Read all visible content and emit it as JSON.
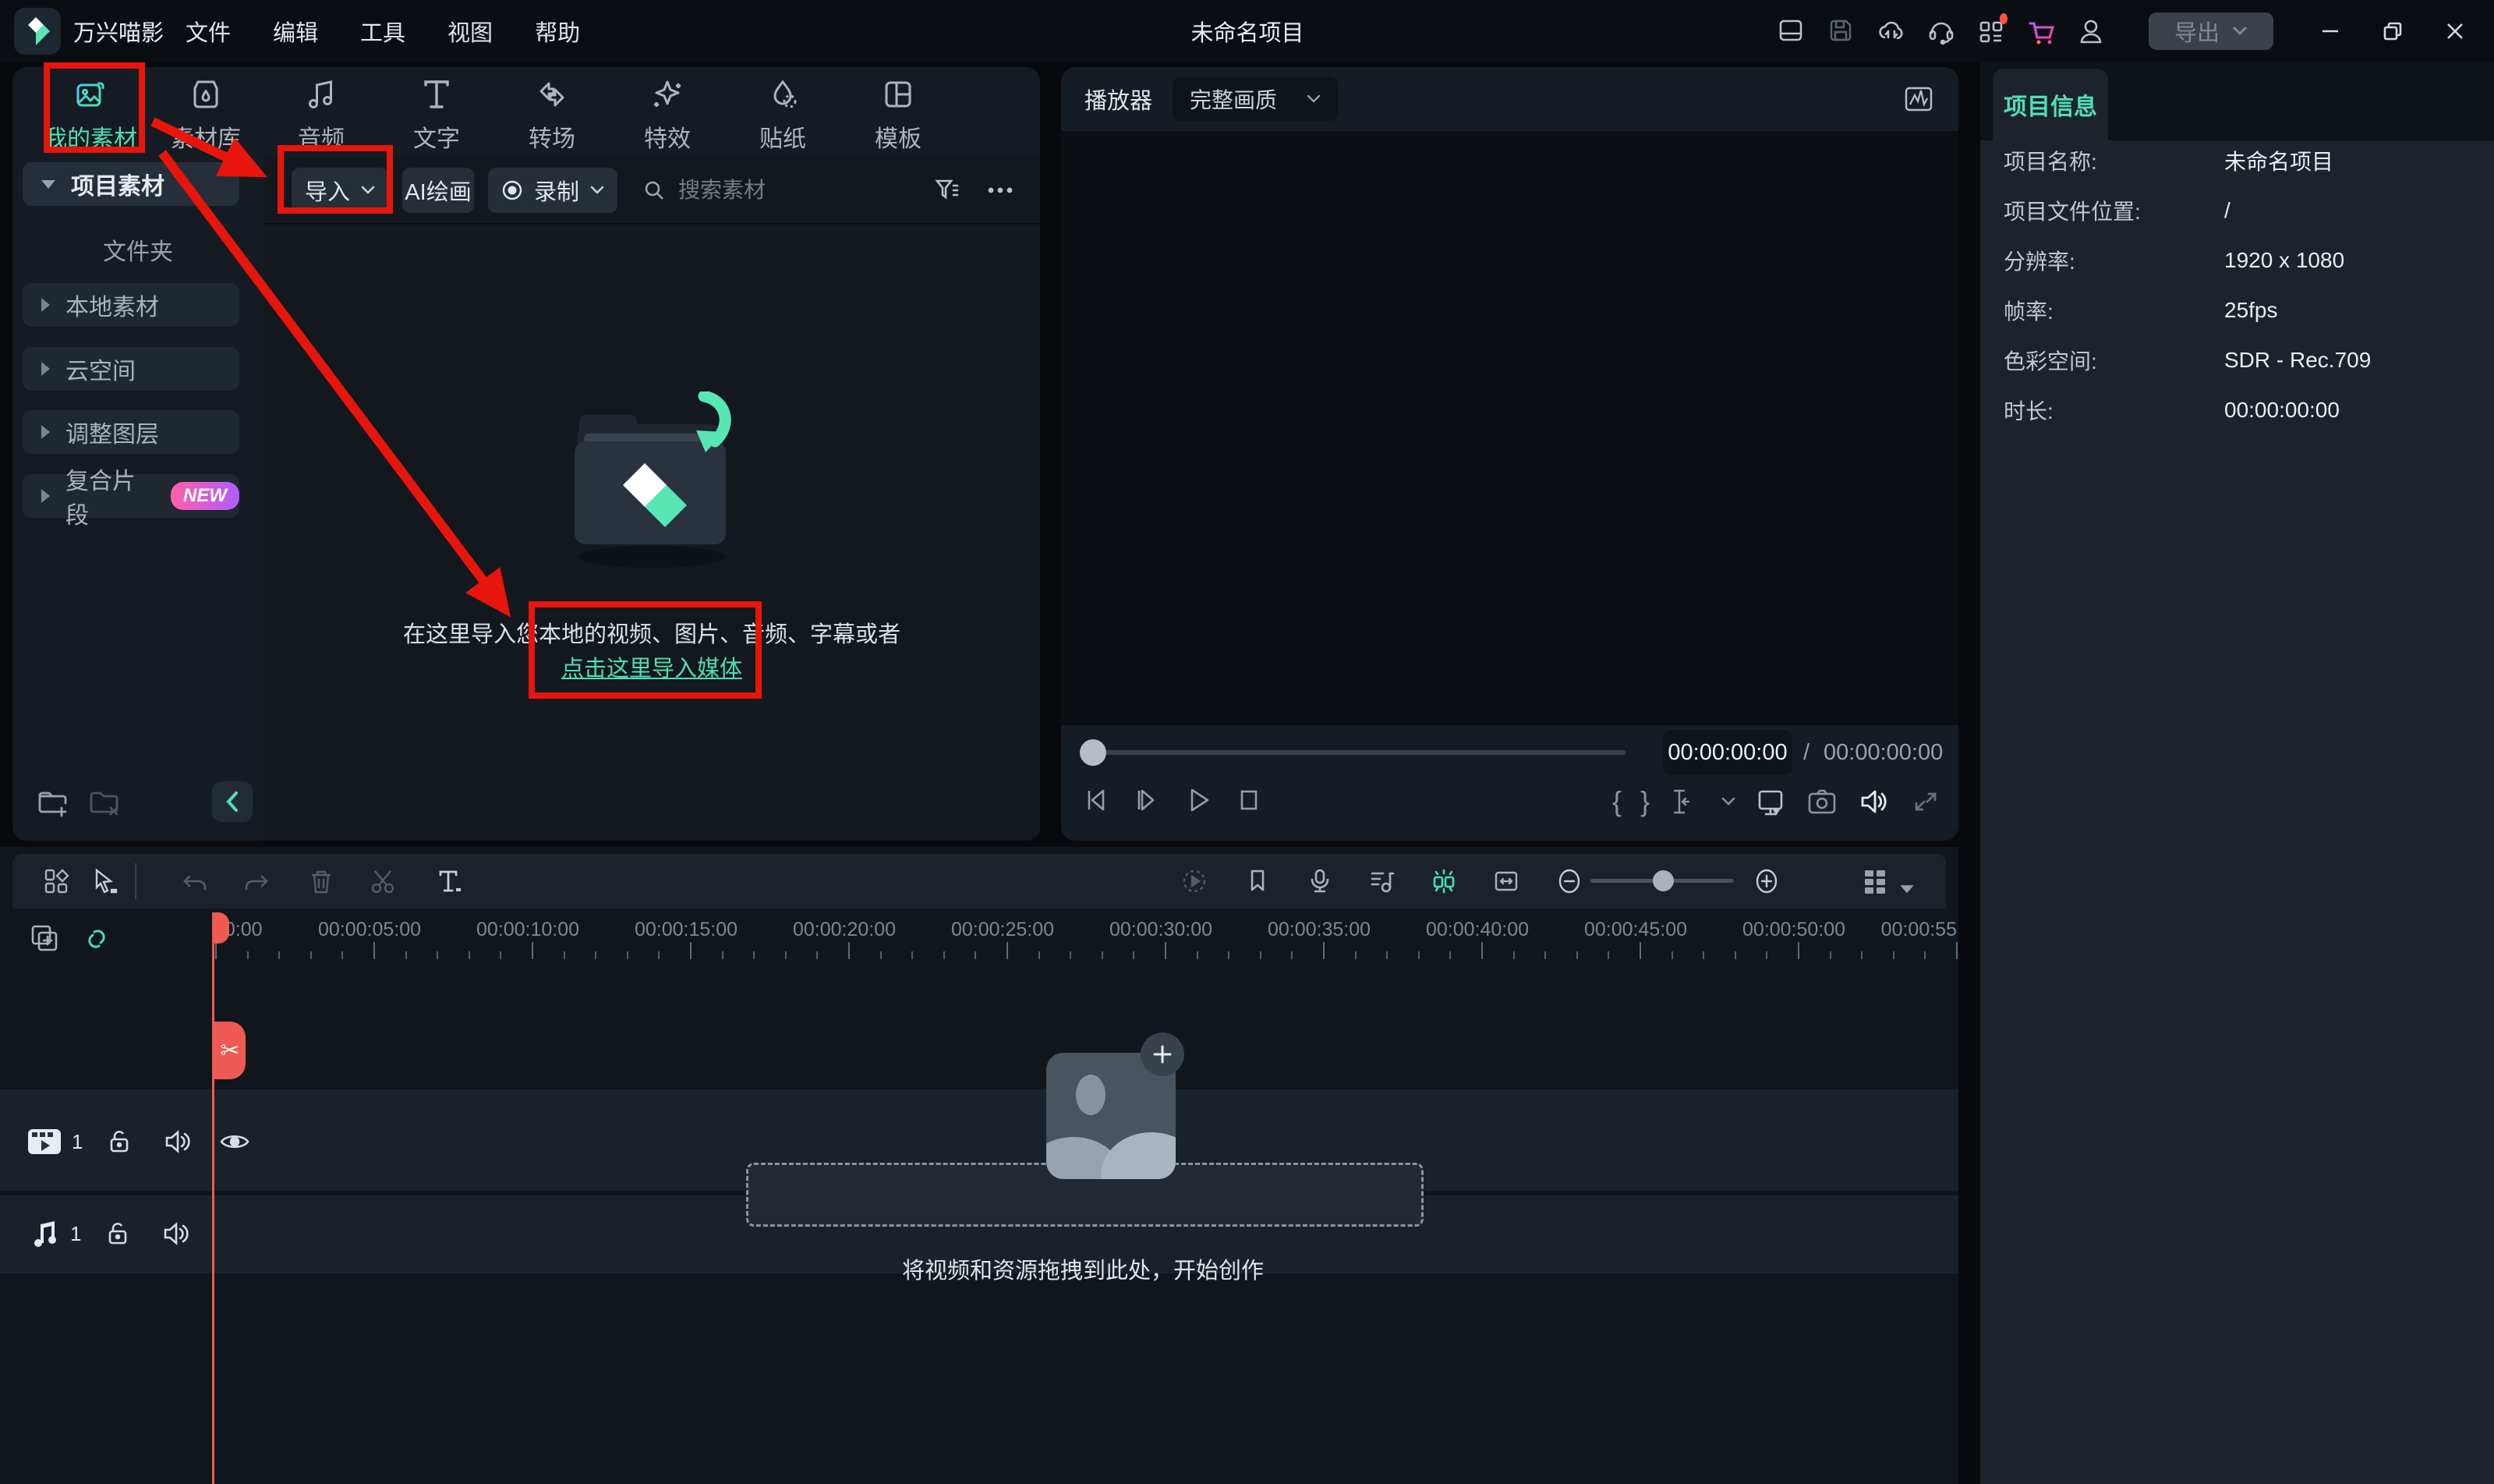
{
  "titlebar": {
    "app_name": "万兴喵影",
    "menus": [
      {
        "label": "文件"
      },
      {
        "label": "编辑"
      },
      {
        "label": "工具"
      },
      {
        "label": "视图"
      },
      {
        "label": "帮助"
      }
    ],
    "project_title": "未命名项目",
    "export_label": "导出"
  },
  "media_panel": {
    "tabs": [
      {
        "label": "我的素材",
        "active": true
      },
      {
        "label": "素材库"
      },
      {
        "label": "音频"
      },
      {
        "label": "文字"
      },
      {
        "label": "转场"
      },
      {
        "label": "特效"
      },
      {
        "label": "贴纸"
      },
      {
        "label": "模板"
      }
    ],
    "sidebar": {
      "project_item": "项目素材",
      "folder_child": "文件夹",
      "items": [
        {
          "label": "本地素材"
        },
        {
          "label": "云空间"
        },
        {
          "label": "调整图层"
        },
        {
          "label": "复合片段",
          "badge": "NEW"
        }
      ]
    },
    "toolbar": {
      "import_label": "导入",
      "ai_label": "AI绘画",
      "record_label": "录制",
      "search_placeholder": "搜索素材"
    },
    "empty_state": {
      "line1": "在这里导入您本地的视频、图片、音频、字幕或者",
      "link": "点击这里导入媒体"
    }
  },
  "player": {
    "label": "播放器",
    "quality": "完整画质",
    "current_time": "00:00:00:00",
    "separator": "/",
    "total_time": "00:00:00:00"
  },
  "project_info": {
    "tab_label": "项目信息",
    "fields": [
      {
        "label": "项目名称:",
        "value": "未命名项目"
      },
      {
        "label": "项目文件位置:",
        "value": "/"
      },
      {
        "label": "分辨率:",
        "value": "1920 x 1080"
      },
      {
        "label": "帧率:",
        "value": "25fps"
      },
      {
        "label": "色彩空间:",
        "value": "SDR - Rec.709"
      },
      {
        "label": "时长:",
        "value": "00:00:00:00"
      }
    ]
  },
  "timeline": {
    "ruler_labels": [
      "00:00",
      "00:00:05:00",
      "00:00:10:00",
      "00:00:15:00",
      "00:00:20:00",
      "00:00:25:00",
      "00:00:30:00",
      "00:00:35:00",
      "00:00:40:00",
      "00:00:45:00",
      "00:00:50:00",
      "00:00:55"
    ],
    "drop_hint": "将视频和资源拖拽到此处，开始创作",
    "video_track_number": "1",
    "audio_track_number": "1"
  },
  "glyphs": {
    "brace_open": "{",
    "brace_close": "}",
    "scissors": "✂"
  },
  "colors": {
    "accent_teal": "#4fe0b2",
    "annotation_red": "#e7150b",
    "playhead_red": "#ef5a52",
    "badge_gradient_start": "#ff5fa8",
    "badge_gradient_end": "#b05cff"
  }
}
